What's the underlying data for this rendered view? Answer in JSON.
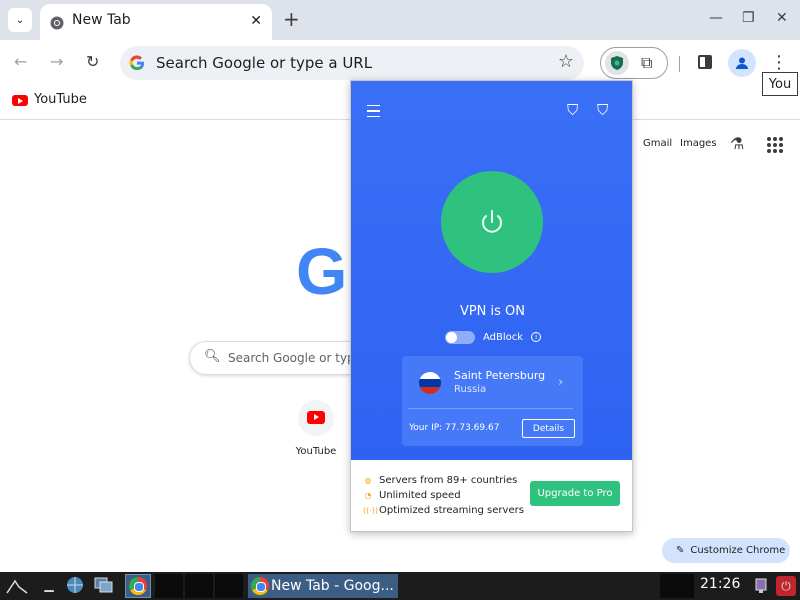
{
  "browser": {
    "tab_title": "New Tab",
    "omnibox_placeholder": "Search Google or type a URL",
    "tooltip": "You",
    "bookmark": "YouTube"
  },
  "ntp": {
    "links": [
      "Gmail",
      "Images"
    ],
    "logo_letter": "G",
    "search_placeholder": "Search Google or type a",
    "shortcut_label": "YouTube",
    "customize_label": "Customize Chrome"
  },
  "vpn_popup": {
    "status": "VPN is ON",
    "adblock_label": "AdBlock",
    "adblock_enabled": false,
    "city": "Saint Petersburg",
    "country": "Russia",
    "ip_text": "Your IP: 77.73.69.67",
    "details_label": "Details",
    "features": [
      "Servers from 89+ countries",
      "Unlimited speed",
      "Optimized streaming servers"
    ],
    "upgrade_label": "Upgrade to Pro",
    "colors": {
      "accent_blue": "#3a6ff6",
      "accent_green": "#2ec27e"
    }
  },
  "taskbar": {
    "window_title": "New Tab - Goog...",
    "clock": "21:26"
  }
}
